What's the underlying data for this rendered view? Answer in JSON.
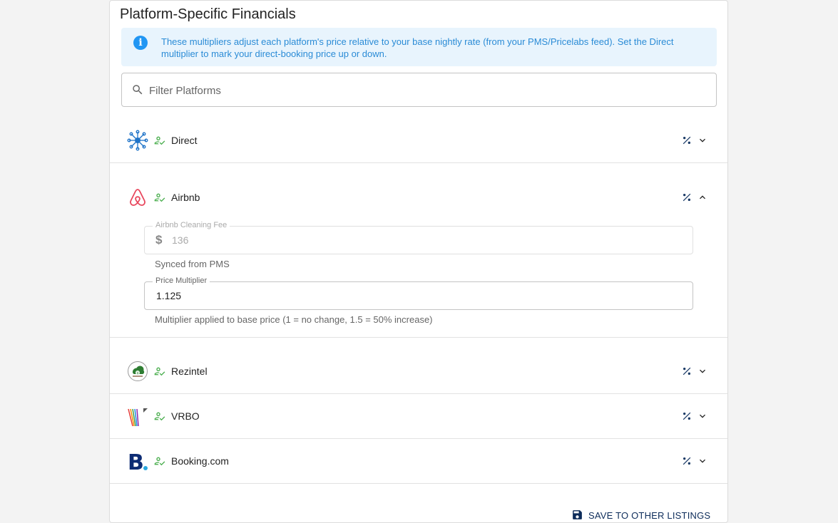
{
  "section": {
    "title": "Platform-Specific Financials"
  },
  "info": {
    "text": "These multipliers adjust each platform's price relative to your base nightly rate (from your PMS/Pricelabs feed). Set the Direct multiplier to mark your direct-booking price up or down."
  },
  "search": {
    "placeholder": "Filter Platforms",
    "value": ""
  },
  "platforms": [
    {
      "name": "Direct",
      "expanded": false,
      "logo": "direct-network-icon"
    },
    {
      "name": "Airbnb",
      "expanded": true,
      "logo": "airbnb-logo",
      "cleaning_fee": {
        "label": "Airbnb Cleaning Fee",
        "value": "136",
        "helper": "Synced from PMS",
        "prefix": "$"
      },
      "multiplier": {
        "label": "Price Multiplier",
        "value": "1.125",
        "helper": "Multiplier applied to base price (1 = no change, 1.5 = 50% increase)"
      }
    },
    {
      "name": "Rezintel",
      "expanded": false,
      "logo": "rezintel-logo"
    },
    {
      "name": "VRBO",
      "expanded": false,
      "logo": "vrbo-logo"
    },
    {
      "name": "Booking.com",
      "expanded": false,
      "logo": "booking-logo"
    }
  ],
  "actions": {
    "save_label": "SAVE TO OTHER LISTINGS"
  },
  "colors": {
    "info_bg": "#e8f4fd",
    "info_text": "#2a8bd6",
    "check_green": "#4caf50",
    "navy": "#0d2c5a",
    "airbnb": "#e8475d"
  }
}
